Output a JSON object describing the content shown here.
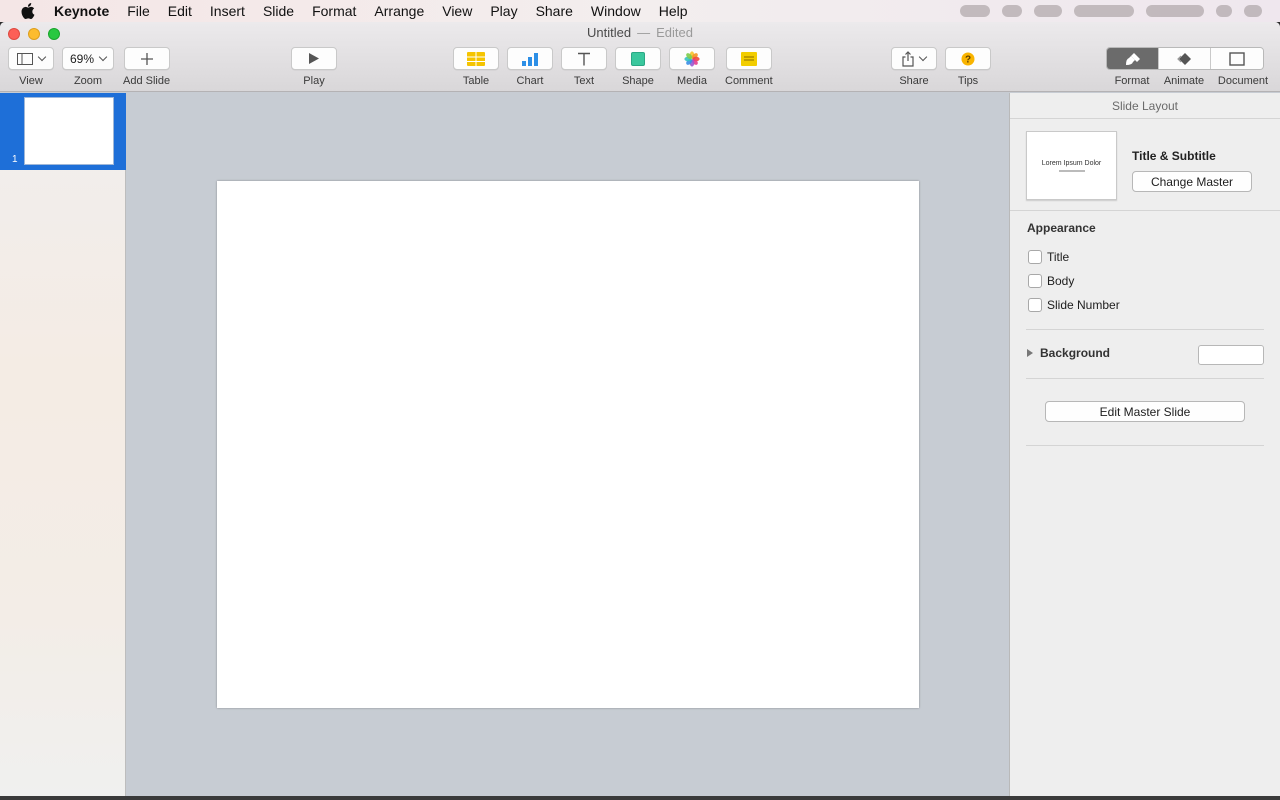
{
  "menubar": {
    "app": "Keynote",
    "items": [
      "File",
      "Edit",
      "Insert",
      "Slide",
      "Format",
      "Arrange",
      "View",
      "Play",
      "Share",
      "Window",
      "Help"
    ]
  },
  "window": {
    "title": "Untitled",
    "separator": "—",
    "status": "Edited"
  },
  "toolbar": {
    "view": "View",
    "zoom_value": "69%",
    "zoom": "Zoom",
    "add_slide": "Add Slide",
    "play": "Play",
    "table": "Table",
    "chart": "Chart",
    "text": "Text",
    "shape": "Shape",
    "media": "Media",
    "comment": "Comment",
    "share": "Share",
    "tips": "Tips",
    "format": "Format",
    "animate": "Animate",
    "document": "Document",
    "icons": {
      "table": "table-icon",
      "chart": "chart-icon",
      "text": "text-icon",
      "shape": "shape-icon",
      "media": "media-icon",
      "comment": "comment-icon"
    },
    "accent_colors": {
      "table": "#f5c400",
      "chart": "#2d8fe6",
      "shape": "#3ac79d",
      "comment": "#f2cd00",
      "tips": "#f9b400"
    }
  },
  "navigator": {
    "slides": [
      {
        "number": "1",
        "selected": true
      }
    ],
    "selection_color": "#1e6fd8"
  },
  "inspector": {
    "header": "Slide Layout",
    "master_thumb_title": "Lorem Ipsum Dolor",
    "master_name": "Title & Subtitle",
    "change_master": "Change Master",
    "appearance": "Appearance",
    "checks": [
      {
        "label": "Title",
        "checked": false
      },
      {
        "label": "Body",
        "checked": false
      },
      {
        "label": "Slide Number",
        "checked": false
      }
    ],
    "background": "Background",
    "edit_master": "Edit Master Slide"
  }
}
